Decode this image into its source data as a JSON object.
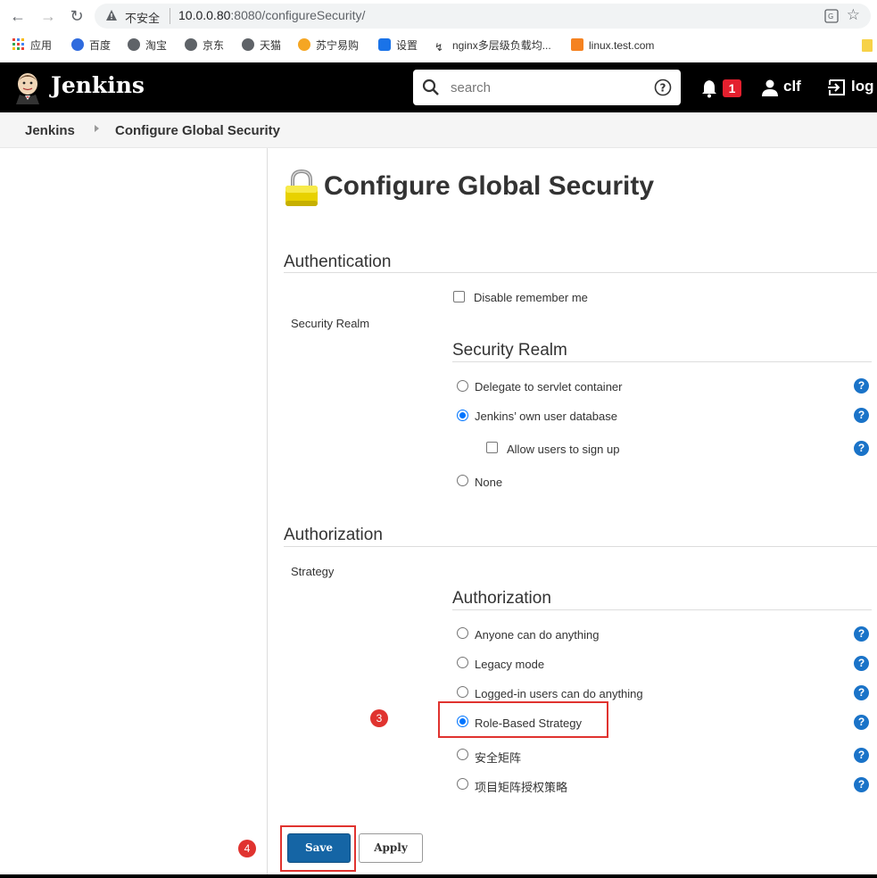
{
  "browser": {
    "insecure_label": "不安全",
    "url_host": "10.0.0.80",
    "url_rest": ":8080/configureSecurity/",
    "bookmarks": [
      {
        "label": "应用"
      },
      {
        "label": "百度"
      },
      {
        "label": "淘宝"
      },
      {
        "label": "京东"
      },
      {
        "label": "天猫"
      },
      {
        "label": "苏宁易购"
      },
      {
        "label": "设置"
      },
      {
        "label": "nginx多层级负载均..."
      },
      {
        "label": "linux.test.com"
      }
    ]
  },
  "header": {
    "title": "Jenkins",
    "search_placeholder": "search",
    "notification_count": "1",
    "user_name": "clf",
    "logout_label": "log"
  },
  "breadcrumb": {
    "items": [
      "Jenkins",
      "Configure Global Security"
    ]
  },
  "page": {
    "title": "Configure Global Security"
  },
  "authentication": {
    "heading": "Authentication",
    "disable_remember_me": "Disable remember me",
    "row_label": "Security Realm",
    "sub_heading": "Security Realm",
    "options": [
      {
        "label": "Delegate to servlet container",
        "selected": false
      },
      {
        "label": "Jenkins’ own user database",
        "selected": true
      },
      {
        "label": "Allow users to sign up",
        "checkbox": true,
        "checked": false
      },
      {
        "label": "None",
        "selected": false
      }
    ]
  },
  "authorization": {
    "heading": "Authorization",
    "row_label": "Strategy",
    "sub_heading": "Authorization",
    "options": [
      {
        "label": "Anyone can do anything",
        "selected": false
      },
      {
        "label": "Legacy mode",
        "selected": false
      },
      {
        "label": "Logged-in users can do anything",
        "selected": false
      },
      {
        "label": "Role-Based Strategy",
        "selected": true
      },
      {
        "label": "安全矩阵",
        "selected": false
      },
      {
        "label": "项目矩阵授权策略",
        "selected": false
      }
    ]
  },
  "annotations": {
    "step3": "3",
    "step4": "4"
  },
  "buttons": {
    "save": "Save",
    "apply": "Apply"
  },
  "help_label": "?"
}
